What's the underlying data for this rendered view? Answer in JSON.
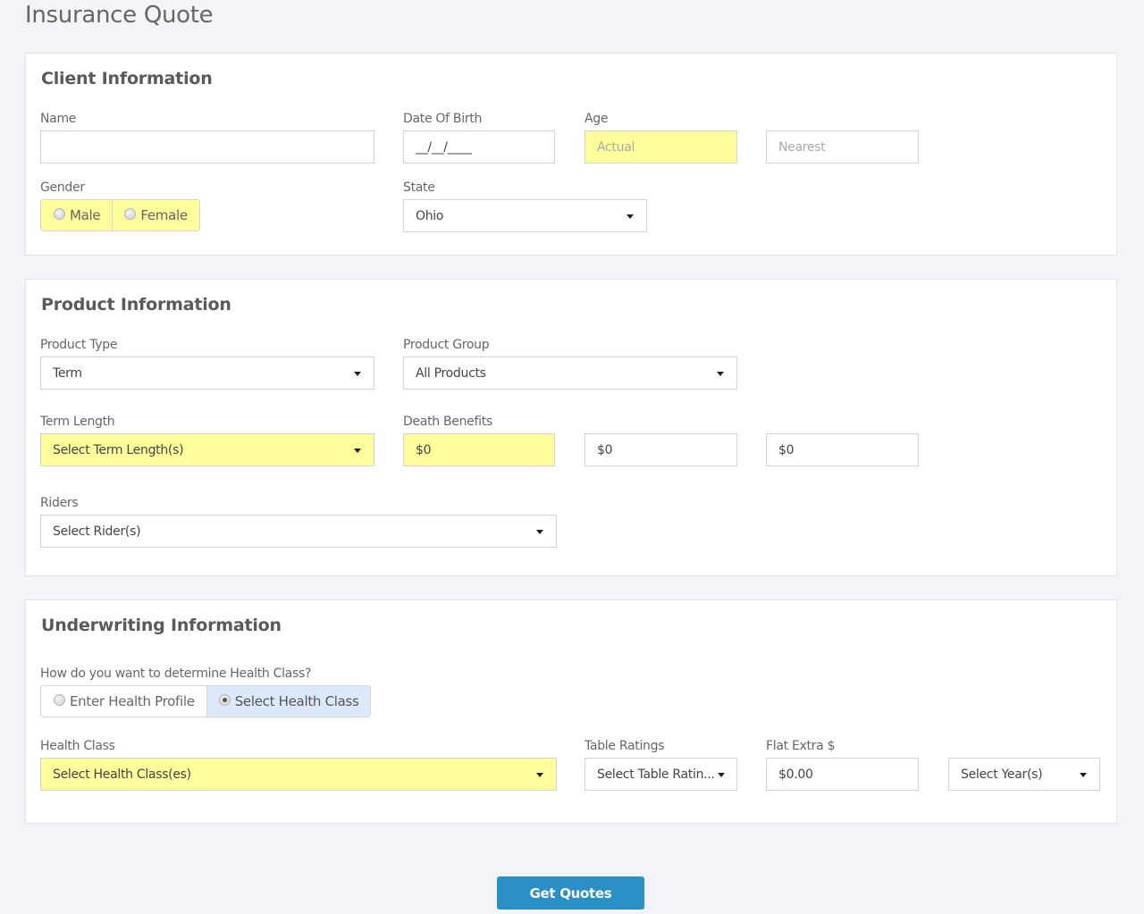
{
  "page": {
    "title": "Insurance Quote"
  },
  "client": {
    "title": "Client Information",
    "name": {
      "label": "Name",
      "value": "",
      "placeholder": ""
    },
    "dob": {
      "label": "Date Of Birth",
      "value": "__/__/____"
    },
    "age": {
      "label": "Age",
      "actual_placeholder": "Actual",
      "nearest_placeholder": "Nearest"
    },
    "gender": {
      "label": "Gender",
      "options": [
        "Male",
        "Female"
      ],
      "selected": null
    },
    "state": {
      "label": "State",
      "value": "Ohio"
    }
  },
  "product": {
    "title": "Product Information",
    "product_type": {
      "label": "Product Type",
      "value": "Term"
    },
    "product_group": {
      "label": "Product Group",
      "value": "All Products"
    },
    "term_length": {
      "label": "Term Length",
      "value": "Select Term Length(s)"
    },
    "death_benefits": {
      "label": "Death Benefits",
      "values": [
        "$0",
        "$0",
        "$0"
      ]
    },
    "riders": {
      "label": "Riders",
      "value": "Select Rider(s)"
    }
  },
  "underwriting": {
    "title": "Underwriting Information",
    "method": {
      "label": "How do you want to determine Health Class?",
      "options": [
        "Enter Health Profile",
        "Select Health Class"
      ],
      "selected": "Select Health Class"
    },
    "health_class": {
      "label": "Health Class",
      "value": "Select Health Class(es)"
    },
    "table_ratings": {
      "label": "Table Ratings",
      "value": "Select Table Ratin..."
    },
    "flat_extra": {
      "label": "Flat Extra $",
      "value": "$0.00"
    },
    "years": {
      "value": "Select Year(s)"
    }
  },
  "actions": {
    "get_quotes": "Get Quotes"
  },
  "colors": {
    "highlight_required": "#fefd9c",
    "selected_option": "#dce9fb",
    "primary_button": "#2a8fc5",
    "page_background": "#f3f4f8"
  }
}
